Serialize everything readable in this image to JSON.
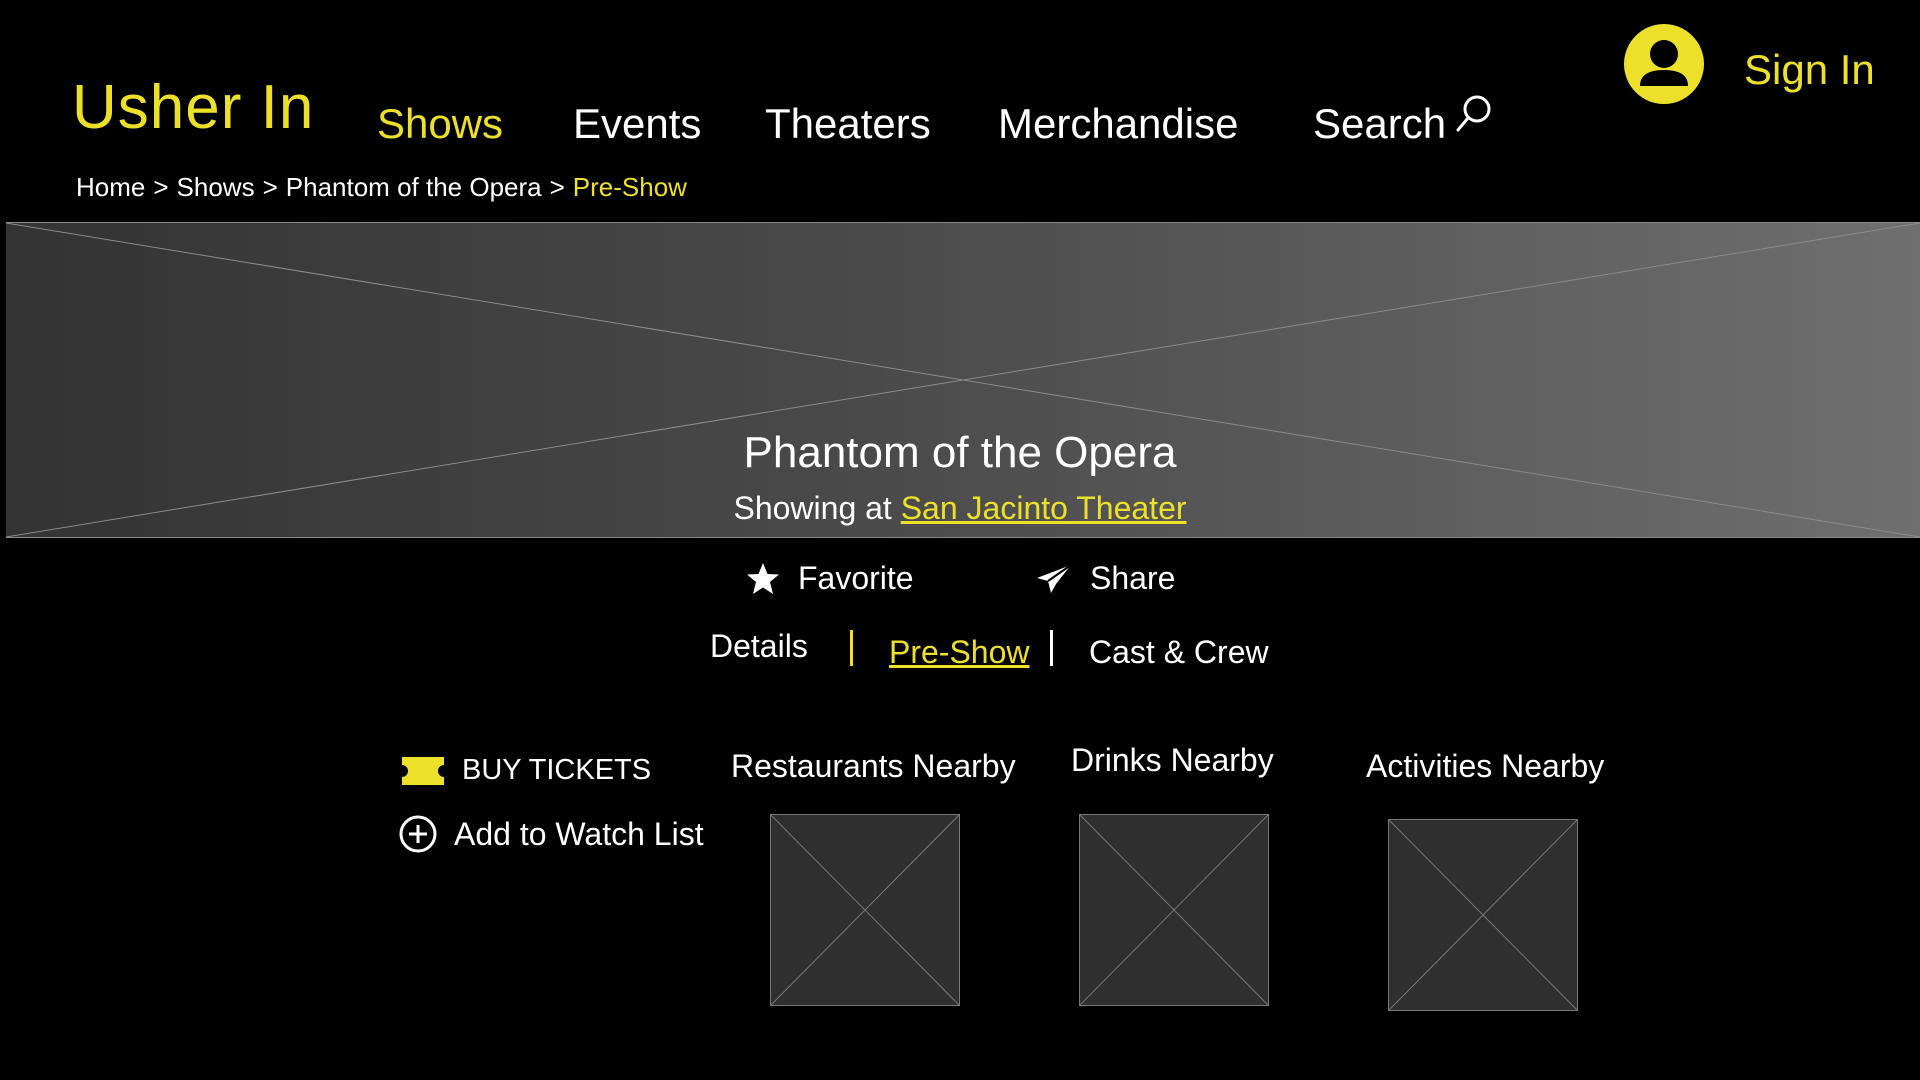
{
  "header": {
    "logo": "Usher In",
    "nav": {
      "shows": "Shows",
      "events": "Events",
      "theaters": "Theaters",
      "merchandise": "Merchandise",
      "search": "Search"
    },
    "sign_in": "Sign In"
  },
  "breadcrumb": {
    "home": "Home",
    "shows": "Shows",
    "show": "Phantom of the Opera",
    "current": "Pre-Show",
    "separator": ">"
  },
  "hero": {
    "title": "Phantom of the Opera",
    "showing_at": "Showing at",
    "theater": "San Jacinto Theater"
  },
  "actions": {
    "favorite": "Favorite",
    "share": "Share"
  },
  "tabs": {
    "details": "Details",
    "preshow": "Pre-Show",
    "cast": "Cast & Crew"
  },
  "sidebar": {
    "buy_tickets": "BUY TICKETS",
    "watch_list": "Add to Watch List"
  },
  "nearby": {
    "restaurants": "Restaurants Nearby",
    "drinks": "Drinks Nearby",
    "activities": "Activities Nearby"
  },
  "colors": {
    "accent": "#ede02a",
    "background": "#000000",
    "text": "#ffffff"
  }
}
